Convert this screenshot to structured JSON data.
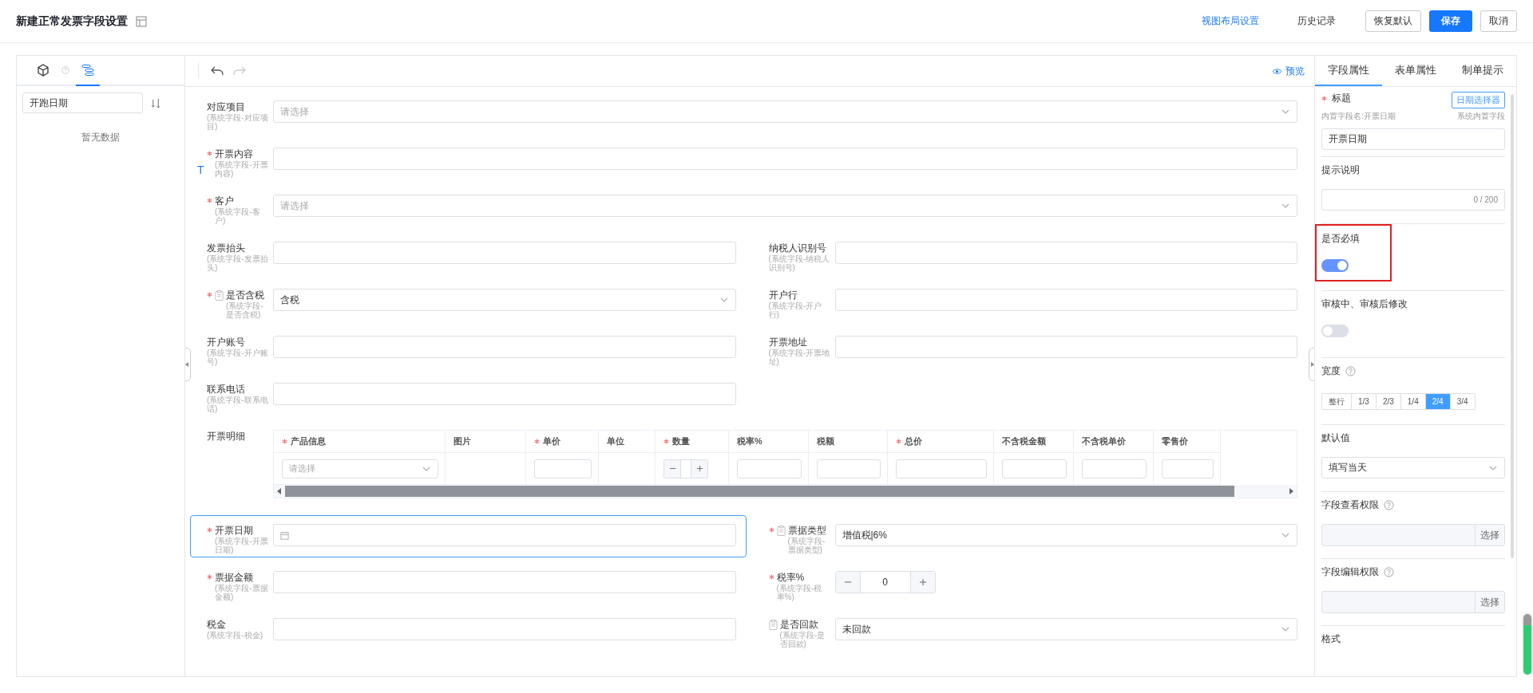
{
  "header": {
    "title": "新建正常发票字段设置",
    "buttons": [
      {
        "label": "视图布局设置",
        "kind": "link"
      },
      {
        "label": "历史记录",
        "kind": "text"
      },
      {
        "label": "恢复默认",
        "kind": "default"
      },
      {
        "label": "保存",
        "kind": "primary"
      },
      {
        "label": "取消",
        "kind": "default"
      }
    ]
  },
  "left_panel": {
    "tabs": [
      {
        "kind": "cube",
        "selected": false
      },
      {
        "kind": "outline",
        "selected": true
      }
    ],
    "search": {
      "value": "开跑日期"
    },
    "empty_text": "暂无数据"
  },
  "form": {
    "preview": "预览",
    "top_fields": [
      {
        "kind": "select",
        "label": "对应项目",
        "sublabel": "(系统字段-对应项目)",
        "required": false,
        "doc_icon": false,
        "placeholder": "请选择",
        "selected": false
      },
      {
        "kind": "input",
        "label": "开票内容",
        "sublabel": "(系统字段-开票内容)",
        "required": true,
        "doc_icon": false,
        "marker": "T",
        "selected": false
      },
      {
        "kind": "select",
        "label": "客户",
        "sublabel": "(系统字段-客户)",
        "required": true,
        "doc_icon": false,
        "placeholder": "请选择",
        "selected": false
      }
    ],
    "pair_fields": [
      {
        "kind": "input",
        "label": "发票抬头",
        "sublabel": "(系统字段-发票抬头)",
        "required": false,
        "doc_icon": false,
        "selected": false
      },
      {
        "kind": "input",
        "label": "纳税人识别号",
        "sublabel": "(系统字段-纳税人识别号)",
        "required": false,
        "doc_icon": false,
        "selected": false
      },
      {
        "kind": "select",
        "label": "是否含税",
        "sublabel": "(系统字段-是否含税)",
        "required": true,
        "doc_icon": true,
        "value": "含税",
        "selected": false
      },
      {
        "kind": "input",
        "label": "开户行",
        "sublabel": "(系统字段-开户行)",
        "required": false,
        "doc_icon": false,
        "selected": false
      },
      {
        "kind": "input",
        "label": "开户账号",
        "sublabel": "(系统字段-开户账号)",
        "required": false,
        "doc_icon": false,
        "selected": false
      },
      {
        "kind": "input",
        "label": "开票地址",
        "sublabel": "(系统字段-开票地址)",
        "required": false,
        "doc_icon": false,
        "selected": false
      },
      {
        "kind": "input",
        "label": "联系电话",
        "sublabel": "(系统字段-联系电话)",
        "required": false,
        "doc_icon": false,
        "selected": false
      }
    ],
    "detail_table": {
      "label": "开票明细",
      "selected": false,
      "columns": [
        {
          "label": "产品信息",
          "required": true
        },
        {
          "label": "图片",
          "required": false
        },
        {
          "label": "单价",
          "required": true
        },
        {
          "label": "单位",
          "required": false
        },
        {
          "label": "数量",
          "required": true
        },
        {
          "label": "税率%",
          "required": false
        },
        {
          "label": "税额",
          "required": false
        },
        {
          "label": "总价",
          "required": true
        },
        {
          "label": "不含税金额",
          "required": false
        },
        {
          "label": "不含税单价",
          "required": false
        },
        {
          "label": "零售价",
          "required": false
        }
      ],
      "cells": [
        {
          "kind": "select",
          "placeholder": "请选择"
        },
        {
          "kind": "blank"
        },
        {
          "kind": "input"
        },
        {
          "kind": "blank"
        },
        {
          "kind": "stepper"
        },
        {
          "kind": "input"
        },
        {
          "kind": "input"
        },
        {
          "kind": "input"
        },
        {
          "kind": "input"
        },
        {
          "kind": "input"
        },
        {
          "kind": "input"
        }
      ]
    },
    "lower_fields": [
      {
        "kind": "date",
        "label": "开票日期",
        "sublabel": "(系统字段-开票日期)",
        "required": true,
        "doc_icon": false,
        "selected": true
      },
      {
        "kind": "select",
        "label": "票据类型",
        "sublabel": "(系统字段-票据类型)",
        "required": true,
        "doc_icon": true,
        "value": "增值税|6%",
        "selected": false
      },
      {
        "kind": "input",
        "label": "票据金额",
        "sublabel": "(系统字段-票据金额)",
        "required": true,
        "doc_icon": false,
        "selected": false
      },
      {
        "kind": "number",
        "label": "税率%",
        "sublabel": "(系统字段-税率%)",
        "required": true,
        "doc_icon": false,
        "value": "0",
        "selected": false
      },
      {
        "kind": "input",
        "label": "税金",
        "sublabel": "(系统字段-税金)",
        "required": false,
        "doc_icon": false,
        "selected": false
      },
      {
        "kind": "select",
        "label": "是否回款",
        "sublabel": "(系统字段-是否回款)",
        "required": false,
        "doc_icon": true,
        "value": "未回款",
        "selected": false
      }
    ]
  },
  "prop_panel": {
    "tabs": [
      {
        "label": "字段属性",
        "selected": true
      },
      {
        "label": "表单属性",
        "selected": false
      },
      {
        "label": "制单提示",
        "selected": false
      }
    ],
    "sections": [
      {
        "kind": "title",
        "label": "标题",
        "required": true,
        "badge": "日期选择器",
        "hint_left": "内置字段名:开票日期",
        "hint_right": "系统内置字段",
        "value": "开票日期"
      },
      {
        "kind": "text_area",
        "label": "提示说明",
        "counter": "0 / 200"
      },
      {
        "kind": "toggle",
        "label": "是否必填",
        "on": true,
        "highlighted": true
      },
      {
        "kind": "toggle",
        "label": "审核中、审核后修改",
        "on": false,
        "highlighted": false
      },
      {
        "kind": "segments",
        "label": "宽度",
        "help": true,
        "options": [
          {
            "label": "整行",
            "selected": false
          },
          {
            "label": "1/3",
            "selected": false
          },
          {
            "label": "2/3",
            "selected": false
          },
          {
            "label": "1/4",
            "selected": false
          },
          {
            "label": "2/4",
            "selected": true
          },
          {
            "label": "3/4",
            "selected": false
          }
        ]
      },
      {
        "kind": "select",
        "label": "默认值",
        "value": "填写当天"
      },
      {
        "kind": "picker",
        "label": "字段查看权限",
        "help": true,
        "button": "选择"
      },
      {
        "kind": "picker",
        "label": "字段编辑权限",
        "help": true,
        "button": "选择"
      },
      {
        "kind": "heading",
        "label": "格式"
      }
    ]
  }
}
